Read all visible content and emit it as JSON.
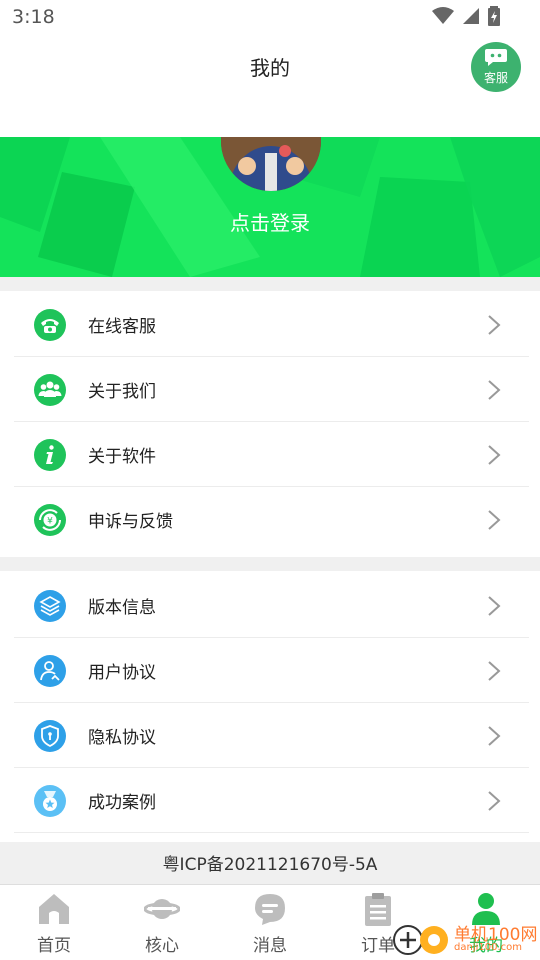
{
  "status_bar": {
    "time": "3:18"
  },
  "header": {
    "title": "我的",
    "service_label": "客服"
  },
  "profile": {
    "login_text": "点击登录"
  },
  "menu_group_1": [
    {
      "label": "在线客服",
      "icon": "phone-icon",
      "color": "#1fc35a"
    },
    {
      "label": "关于我们",
      "icon": "group-icon",
      "color": "#1fc35a"
    },
    {
      "label": "关于软件",
      "icon": "info-icon",
      "color": "#1fc35a"
    },
    {
      "label": "申诉与反馈",
      "icon": "yen-refresh-icon",
      "color": "#1fc35a"
    }
  ],
  "menu_group_2": [
    {
      "label": "版本信息",
      "icon": "layers-icon",
      "color": "#2ea0e8"
    },
    {
      "label": "用户协议",
      "icon": "user-agreement-icon",
      "color": "#2ea0e8"
    },
    {
      "label": "隐私协议",
      "icon": "shield-icon",
      "color": "#2ea0e8"
    },
    {
      "label": "成功案例",
      "icon": "medal-icon",
      "color": "#5bc0f5"
    }
  ],
  "footer": {
    "icp": "粤ICP备2021121670号-5A"
  },
  "tabs": [
    {
      "label": "首页",
      "icon": "home-icon"
    },
    {
      "label": "核心",
      "icon": "planet-icon"
    },
    {
      "label": "消息",
      "icon": "message-icon"
    },
    {
      "label": "订单",
      "icon": "clipboard-icon"
    },
    {
      "label": "我的",
      "icon": "person-icon",
      "active": true
    }
  ],
  "watermark": {
    "text": "单机100网",
    "sub": "danji100.com"
  },
  "colors": {
    "accent": "#14e35a",
    "active_tab": "#1fbf4f",
    "service": "#3db26f"
  }
}
